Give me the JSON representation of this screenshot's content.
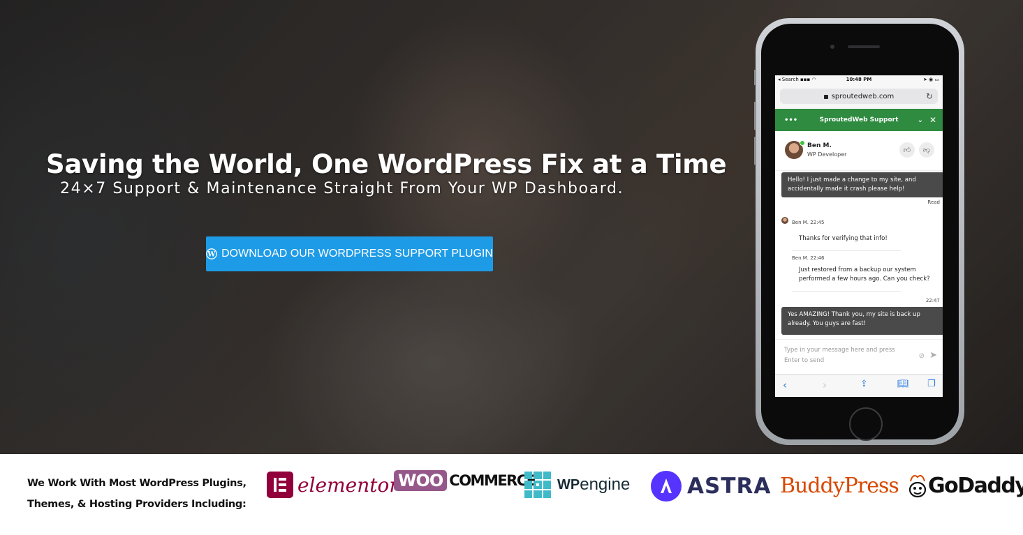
{
  "hero": {
    "headline": "Saving the World, One WordPress Fix at a Time",
    "subheadline": "24×7 Support & Maintenance Straight From Your WP Dashboard.",
    "cta_label": "DOWNLOAD OUR WORDPRESS SUPPORT PLUGIN",
    "cta_color": "#1e9be6"
  },
  "phone": {
    "status": {
      "left": "Search",
      "time": "10:48 PM"
    },
    "url": "sproutedweb.com",
    "chat": {
      "header_title": "SproutedWeb Support",
      "header_color": "#2e8b3f",
      "agent_name": "Ben M.",
      "agent_role": "WP Developer",
      "messages": [
        {
          "text": "Hello! I just made a change to my site, and accidentally made it crash please help!",
          "status": "Read"
        },
        {
          "meta": "Ben M. 22:45",
          "text": "Thanks for verifying that info!"
        },
        {
          "meta": "Ben M. 22:46",
          "text": "Just restored from a backup our system performed a few hours ago. Can you check?"
        },
        {
          "meta": "22:47",
          "text": "Yes AMAZING! Thank you, my site is back up already. You guys are fast!"
        }
      ],
      "input_placeholder": "Type in your message here and press Enter to send"
    }
  },
  "partners": {
    "intro_line1": "We Work With Most WordPress Plugins,",
    "intro_line2": "Themes, & Hosting Providers Including:",
    "logos": {
      "elementor": "elementor",
      "woo_left": "WOO",
      "woo_right": "COMMERCE",
      "wpengine_wp": "WP",
      "wpengine_engine": "engine",
      "astra": "ASTRA",
      "buddypress": "BuddyPress",
      "godaddy": "GoDaddy"
    },
    "colors": {
      "elementor": "#92003b",
      "woo": "#96588a",
      "wpengine": "#40bac8",
      "astra": "#5733ff",
      "buddypress": "#d84800",
      "godaddy": "#111111"
    }
  }
}
